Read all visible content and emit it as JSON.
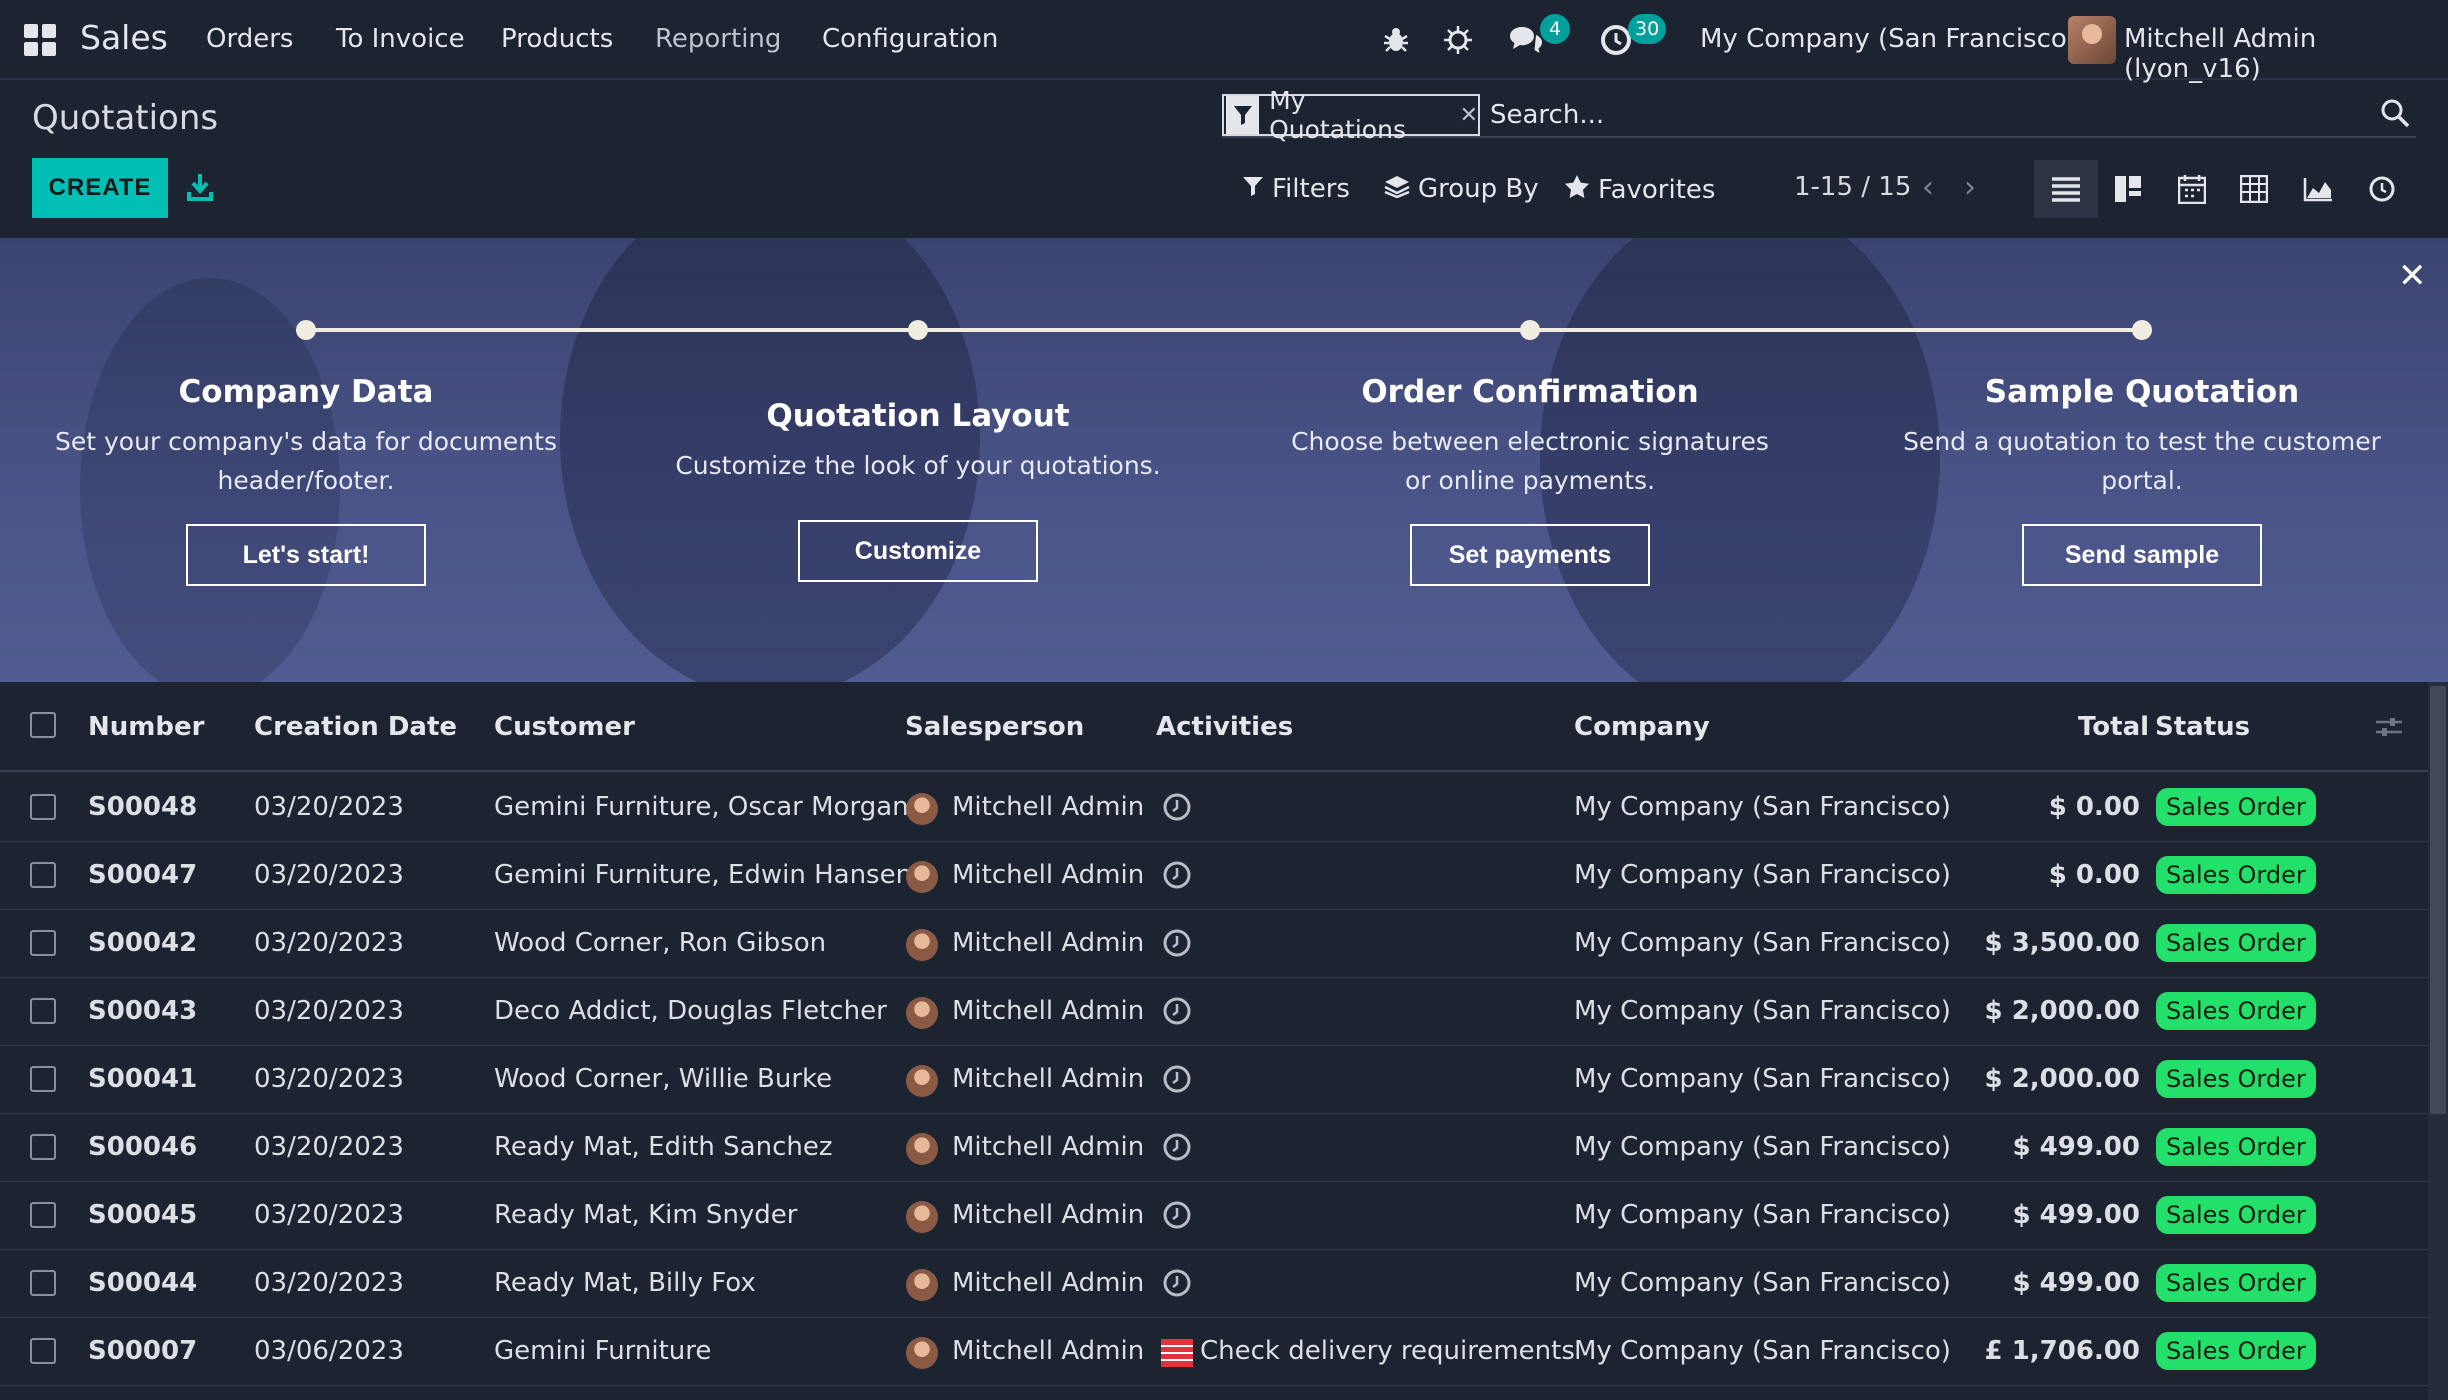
{
  "navbar": {
    "brand": "Sales",
    "menu": [
      "Orders",
      "To Invoice",
      "Products",
      "Reporting",
      "Configuration"
    ],
    "messages_badge": "4",
    "activities_badge": "30",
    "company": "My Company (San Francisco)",
    "user": "Mitchell Admin (lyon_v16)"
  },
  "control_panel": {
    "title": "Quotations",
    "create_label": "CREATE",
    "facet_label": "My Quotations",
    "search_placeholder": "Search...",
    "filters_label": "Filters",
    "groupby_label": "Group By",
    "favorites_label": "Favorites",
    "pager": "1-15 / 15"
  },
  "onboarding": {
    "steps": [
      {
        "title": "Company Data",
        "desc_line1": "Set your company's data for documents",
        "desc_line2": "header/footer.",
        "button": "Let's start!"
      },
      {
        "title": "Quotation Layout",
        "desc_line1": "Customize the look of your quotations.",
        "desc_line2": "",
        "button": "Customize"
      },
      {
        "title": "Order Confirmation",
        "desc_line1": "Choose between electronic signatures",
        "desc_line2": "or online payments.",
        "button": "Set payments"
      },
      {
        "title": "Sample Quotation",
        "desc_line1": "Send a quotation to test the customer",
        "desc_line2": "portal.",
        "button": "Send sample"
      }
    ]
  },
  "table": {
    "columns": {
      "number": "Number",
      "creation_date": "Creation Date",
      "customer": "Customer",
      "salesperson": "Salesperson",
      "activities": "Activities",
      "company": "Company",
      "total": "Total",
      "status": "Status"
    },
    "rows": [
      {
        "number": "S00048",
        "date": "03/20/2023",
        "customer": "Gemini Furniture, Oscar Morgan",
        "salesperson": "Mitchell Admin",
        "activity": "",
        "company": "My Company (San Francisco)",
        "total": "$ 0.00",
        "status": "Sales Order"
      },
      {
        "number": "S00047",
        "date": "03/20/2023",
        "customer": "Gemini Furniture, Edwin Hansen",
        "salesperson": "Mitchell Admin",
        "activity": "",
        "company": "My Company (San Francisco)",
        "total": "$ 0.00",
        "status": "Sales Order"
      },
      {
        "number": "S00042",
        "date": "03/20/2023",
        "customer": "Wood Corner, Ron Gibson",
        "salesperson": "Mitchell Admin",
        "activity": "",
        "company": "My Company (San Francisco)",
        "total": "$ 3,500.00",
        "status": "Sales Order"
      },
      {
        "number": "S00043",
        "date": "03/20/2023",
        "customer": "Deco Addict, Douglas Fletcher",
        "salesperson": "Mitchell Admin",
        "activity": "",
        "company": "My Company (San Francisco)",
        "total": "$ 2,000.00",
        "status": "Sales Order"
      },
      {
        "number": "S00041",
        "date": "03/20/2023",
        "customer": "Wood Corner, Willie Burke",
        "salesperson": "Mitchell Admin",
        "activity": "",
        "company": "My Company (San Francisco)",
        "total": "$ 2,000.00",
        "status": "Sales Order"
      },
      {
        "number": "S00046",
        "date": "03/20/2023",
        "customer": "Ready Mat, Edith Sanchez",
        "salesperson": "Mitchell Admin",
        "activity": "",
        "company": "My Company (San Francisco)",
        "total": "$ 499.00",
        "status": "Sales Order"
      },
      {
        "number": "S00045",
        "date": "03/20/2023",
        "customer": "Ready Mat, Kim Snyder",
        "salesperson": "Mitchell Admin",
        "activity": "",
        "company": "My Company (San Francisco)",
        "total": "$ 499.00",
        "status": "Sales Order"
      },
      {
        "number": "S00044",
        "date": "03/20/2023",
        "customer": "Ready Mat, Billy Fox",
        "salesperson": "Mitchell Admin",
        "activity": "",
        "company": "My Company (San Francisco)",
        "total": "$ 499.00",
        "status": "Sales Order"
      },
      {
        "number": "S00007",
        "date": "03/06/2023",
        "customer": "Gemini Furniture",
        "salesperson": "Mitchell Admin",
        "activity": "Check delivery requirements",
        "company": "My Company (San Francisco)",
        "total": "£ 1,706.00",
        "status": "Sales Order"
      }
    ]
  },
  "colors": {
    "background": "#1c2331",
    "accent": "#00c0b6",
    "status_green": "#22e06a",
    "badge": "#00a09d"
  }
}
